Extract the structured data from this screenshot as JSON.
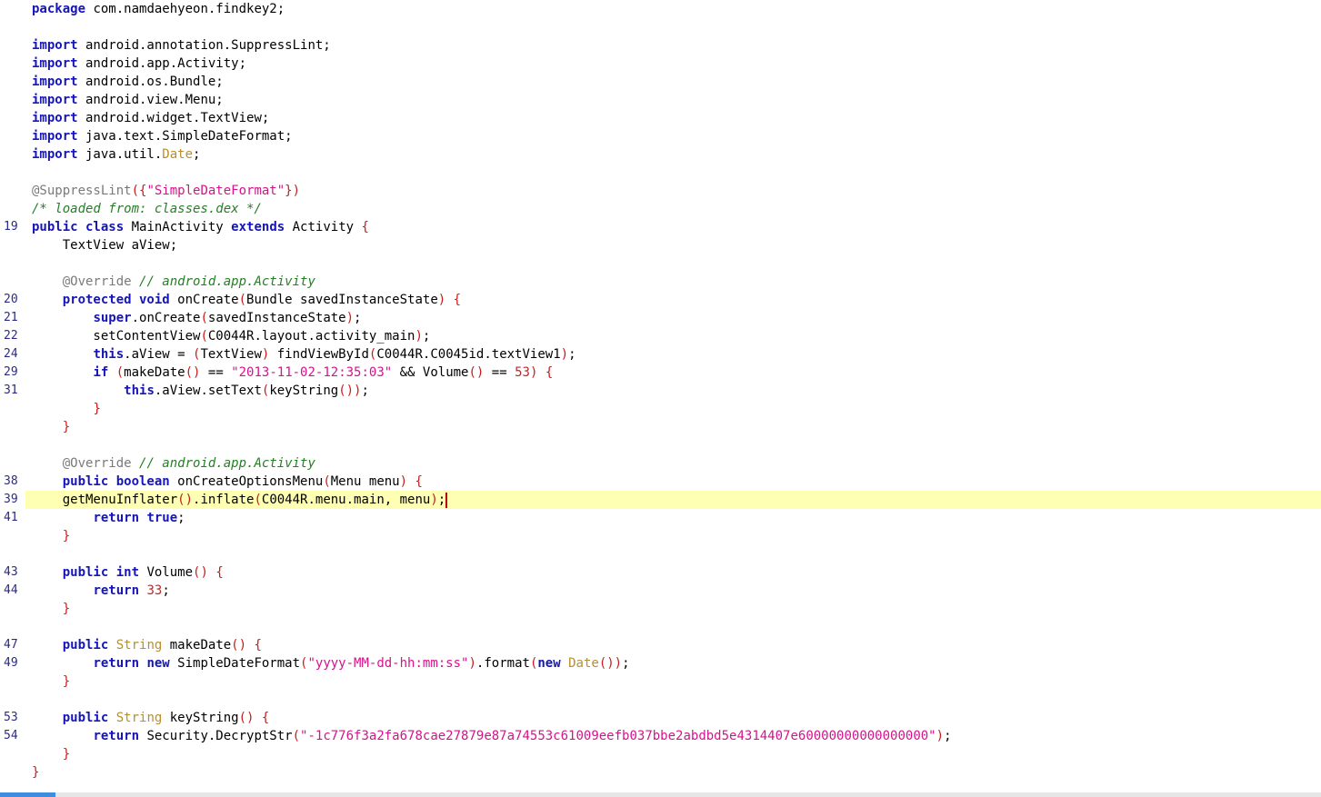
{
  "editor": {
    "lines": [
      {
        "ln": "",
        "tokens": [
          {
            "c": "kw",
            "t": "package"
          },
          {
            "c": "",
            "t": " com.namdaehyeon.findkey2;"
          }
        ]
      },
      {
        "ln": "",
        "tokens": []
      },
      {
        "ln": "",
        "tokens": [
          {
            "c": "kw",
            "t": "import"
          },
          {
            "c": "",
            "t": " android.annotation.SuppressLint;"
          }
        ]
      },
      {
        "ln": "",
        "tokens": [
          {
            "c": "kw",
            "t": "import"
          },
          {
            "c": "",
            "t": " android.app.Activity;"
          }
        ]
      },
      {
        "ln": "",
        "tokens": [
          {
            "c": "kw",
            "t": "import"
          },
          {
            "c": "",
            "t": " android.os.Bundle;"
          }
        ]
      },
      {
        "ln": "",
        "tokens": [
          {
            "c": "kw",
            "t": "import"
          },
          {
            "c": "",
            "t": " android.view.Menu;"
          }
        ]
      },
      {
        "ln": "",
        "tokens": [
          {
            "c": "kw",
            "t": "import"
          },
          {
            "c": "",
            "t": " android.widget.TextView;"
          }
        ]
      },
      {
        "ln": "",
        "tokens": [
          {
            "c": "kw",
            "t": "import"
          },
          {
            "c": "",
            "t": " java.text.SimpleDateFormat;"
          }
        ]
      },
      {
        "ln": "",
        "tokens": [
          {
            "c": "kw",
            "t": "import"
          },
          {
            "c": "",
            "t": " java.util."
          },
          {
            "c": "ty",
            "t": "Date"
          },
          {
            "c": "",
            "t": ";"
          }
        ]
      },
      {
        "ln": "",
        "tokens": []
      },
      {
        "ln": "",
        "tokens": [
          {
            "c": "an",
            "t": "@SuppressLint"
          },
          {
            "c": "br",
            "t": "({"
          },
          {
            "c": "str",
            "t": "\"SimpleDateFormat\""
          },
          {
            "c": "br",
            "t": "})"
          }
        ]
      },
      {
        "ln": "",
        "tokens": [
          {
            "c": "cm",
            "t": "/* loaded from: classes.dex */"
          }
        ]
      },
      {
        "ln": "19",
        "tokens": [
          {
            "c": "kw",
            "t": "public class"
          },
          {
            "c": "",
            "t": " MainActivity "
          },
          {
            "c": "kw",
            "t": "extends"
          },
          {
            "c": "",
            "t": " Activity "
          },
          {
            "c": "br",
            "t": "{"
          }
        ]
      },
      {
        "ln": "",
        "tokens": [
          {
            "c": "",
            "t": "    TextView aView;"
          }
        ]
      },
      {
        "ln": "",
        "tokens": []
      },
      {
        "ln": "",
        "tokens": [
          {
            "c": "",
            "t": "    "
          },
          {
            "c": "an",
            "t": "@Override"
          },
          {
            "c": "",
            "t": " "
          },
          {
            "c": "cm",
            "t": "// android.app.Activity"
          }
        ]
      },
      {
        "ln": "20",
        "tokens": [
          {
            "c": "",
            "t": "    "
          },
          {
            "c": "kw",
            "t": "protected void"
          },
          {
            "c": "",
            "t": " onCreate"
          },
          {
            "c": "br",
            "t": "("
          },
          {
            "c": "",
            "t": "Bundle savedInstanceState"
          },
          {
            "c": "br",
            "t": ")"
          },
          {
            "c": "",
            "t": " "
          },
          {
            "c": "br",
            "t": "{"
          }
        ]
      },
      {
        "ln": "21",
        "tokens": [
          {
            "c": "",
            "t": "        "
          },
          {
            "c": "kw",
            "t": "super"
          },
          {
            "c": "",
            "t": ".onCreate"
          },
          {
            "c": "br",
            "t": "("
          },
          {
            "c": "",
            "t": "savedInstanceState"
          },
          {
            "c": "br",
            "t": ")"
          },
          {
            "c": "",
            "t": ";"
          }
        ]
      },
      {
        "ln": "22",
        "tokens": [
          {
            "c": "",
            "t": "        setContentView"
          },
          {
            "c": "br",
            "t": "("
          },
          {
            "c": "",
            "t": "C0044R.layout.activity_main"
          },
          {
            "c": "br",
            "t": ")"
          },
          {
            "c": "",
            "t": ";"
          }
        ]
      },
      {
        "ln": "24",
        "tokens": [
          {
            "c": "",
            "t": "        "
          },
          {
            "c": "kw",
            "t": "this"
          },
          {
            "c": "",
            "t": ".aView = "
          },
          {
            "c": "br",
            "t": "("
          },
          {
            "c": "",
            "t": "TextView"
          },
          {
            "c": "br",
            "t": ")"
          },
          {
            "c": "",
            "t": " findViewById"
          },
          {
            "c": "br",
            "t": "("
          },
          {
            "c": "",
            "t": "C0044R.C0045id.textView1"
          },
          {
            "c": "br",
            "t": ")"
          },
          {
            "c": "",
            "t": ";"
          }
        ]
      },
      {
        "ln": "29",
        "tokens": [
          {
            "c": "",
            "t": "        "
          },
          {
            "c": "kw",
            "t": "if"
          },
          {
            "c": "",
            "t": " "
          },
          {
            "c": "br",
            "t": "("
          },
          {
            "c": "",
            "t": "makeDate"
          },
          {
            "c": "br",
            "t": "()"
          },
          {
            "c": "",
            "t": " == "
          },
          {
            "c": "str",
            "t": "\"2013-11-02-12:35:03\""
          },
          {
            "c": "",
            "t": " && Volume"
          },
          {
            "c": "br",
            "t": "()"
          },
          {
            "c": "",
            "t": " == "
          },
          {
            "c": "num",
            "t": "53"
          },
          {
            "c": "br",
            "t": ")"
          },
          {
            "c": "",
            "t": " "
          },
          {
            "c": "br",
            "t": "{"
          }
        ]
      },
      {
        "ln": "31",
        "tokens": [
          {
            "c": "",
            "t": "            "
          },
          {
            "c": "kw",
            "t": "this"
          },
          {
            "c": "",
            "t": ".aView.setText"
          },
          {
            "c": "br",
            "t": "("
          },
          {
            "c": "",
            "t": "keyString"
          },
          {
            "c": "br",
            "t": "())"
          },
          {
            "c": "",
            "t": ";"
          }
        ]
      },
      {
        "ln": "",
        "tokens": [
          {
            "c": "",
            "t": "        "
          },
          {
            "c": "br",
            "t": "}"
          }
        ]
      },
      {
        "ln": "",
        "tokens": [
          {
            "c": "",
            "t": "    "
          },
          {
            "c": "br",
            "t": "}"
          }
        ]
      },
      {
        "ln": "",
        "tokens": []
      },
      {
        "ln": "",
        "tokens": [
          {
            "c": "",
            "t": "    "
          },
          {
            "c": "an",
            "t": "@Override"
          },
          {
            "c": "",
            "t": " "
          },
          {
            "c": "cm",
            "t": "// android.app.Activity"
          }
        ]
      },
      {
        "ln": "38",
        "tokens": [
          {
            "c": "",
            "t": "    "
          },
          {
            "c": "kw",
            "t": "public boolean"
          },
          {
            "c": "",
            "t": " onCreateOptionsMenu"
          },
          {
            "c": "br",
            "t": "("
          },
          {
            "c": "",
            "t": "Menu menu"
          },
          {
            "c": "br",
            "t": ")"
          },
          {
            "c": "",
            "t": " "
          },
          {
            "c": "br",
            "t": "{"
          }
        ]
      },
      {
        "ln": "39",
        "current": true,
        "tokens": [
          {
            "c": "",
            "t": "    getMenuInflater"
          },
          {
            "c": "br",
            "t": "()"
          },
          {
            "c": "",
            "t": ".inflate"
          },
          {
            "c": "br",
            "t": "("
          },
          {
            "c": "",
            "t": "C0044R.menu.main, menu"
          },
          {
            "c": "br",
            "t": ")"
          },
          {
            "c": "",
            "t": ";"
          }
        ]
      },
      {
        "ln": "41",
        "tokens": [
          {
            "c": "",
            "t": "        "
          },
          {
            "c": "kw",
            "t": "return true"
          },
          {
            "c": "",
            "t": ";"
          }
        ]
      },
      {
        "ln": "",
        "tokens": [
          {
            "c": "",
            "t": "    "
          },
          {
            "c": "br",
            "t": "}"
          }
        ]
      },
      {
        "ln": "",
        "tokens": []
      },
      {
        "ln": "43",
        "tokens": [
          {
            "c": "",
            "t": "    "
          },
          {
            "c": "kw",
            "t": "public int"
          },
          {
            "c": "",
            "t": " Volume"
          },
          {
            "c": "br",
            "t": "()"
          },
          {
            "c": "",
            "t": " "
          },
          {
            "c": "br",
            "t": "{"
          }
        ]
      },
      {
        "ln": "44",
        "tokens": [
          {
            "c": "",
            "t": "        "
          },
          {
            "c": "kw",
            "t": "return"
          },
          {
            "c": "",
            "t": " "
          },
          {
            "c": "num",
            "t": "33"
          },
          {
            "c": "",
            "t": ";"
          }
        ]
      },
      {
        "ln": "",
        "tokens": [
          {
            "c": "",
            "t": "    "
          },
          {
            "c": "br",
            "t": "}"
          }
        ]
      },
      {
        "ln": "",
        "tokens": []
      },
      {
        "ln": "47",
        "tokens": [
          {
            "c": "",
            "t": "    "
          },
          {
            "c": "kw",
            "t": "public"
          },
          {
            "c": "",
            "t": " "
          },
          {
            "c": "ty",
            "t": "String"
          },
          {
            "c": "",
            "t": " makeDate"
          },
          {
            "c": "br",
            "t": "()"
          },
          {
            "c": "",
            "t": " "
          },
          {
            "c": "br",
            "t": "{"
          }
        ]
      },
      {
        "ln": "49",
        "tokens": [
          {
            "c": "",
            "t": "        "
          },
          {
            "c": "kw",
            "t": "return new"
          },
          {
            "c": "",
            "t": " SimpleDateFormat"
          },
          {
            "c": "br",
            "t": "("
          },
          {
            "c": "str",
            "t": "\"yyyy-MM-dd-hh:mm:ss\""
          },
          {
            "c": "br",
            "t": ")"
          },
          {
            "c": "",
            "t": ".format"
          },
          {
            "c": "br",
            "t": "("
          },
          {
            "c": "kw",
            "t": "new"
          },
          {
            "c": "",
            "t": " "
          },
          {
            "c": "ty",
            "t": "Date"
          },
          {
            "c": "br",
            "t": "())"
          },
          {
            "c": "",
            "t": ";"
          }
        ]
      },
      {
        "ln": "",
        "tokens": [
          {
            "c": "",
            "t": "    "
          },
          {
            "c": "br",
            "t": "}"
          }
        ]
      },
      {
        "ln": "",
        "tokens": []
      },
      {
        "ln": "53",
        "tokens": [
          {
            "c": "",
            "t": "    "
          },
          {
            "c": "kw",
            "t": "public"
          },
          {
            "c": "",
            "t": " "
          },
          {
            "c": "ty",
            "t": "String"
          },
          {
            "c": "",
            "t": " keyString"
          },
          {
            "c": "br",
            "t": "()"
          },
          {
            "c": "",
            "t": " "
          },
          {
            "c": "br",
            "t": "{"
          }
        ]
      },
      {
        "ln": "54",
        "tokens": [
          {
            "c": "",
            "t": "        "
          },
          {
            "c": "kw",
            "t": "return"
          },
          {
            "c": "",
            "t": " Security.DecryptStr"
          },
          {
            "c": "br",
            "t": "("
          },
          {
            "c": "str",
            "t": "\"-1c776f3a2fa678cae27879e87a74553c61009eefb037bbe2abdbd5e4314407e60000000000000000\""
          },
          {
            "c": "br",
            "t": ")"
          },
          {
            "c": "",
            "t": ";"
          }
        ]
      },
      {
        "ln": "",
        "tokens": [
          {
            "c": "",
            "t": "    "
          },
          {
            "c": "br",
            "t": "}"
          }
        ]
      },
      {
        "ln": "",
        "tokens": [
          {
            "c": "br",
            "t": "}"
          }
        ]
      }
    ]
  },
  "colors": {
    "keyword": "#1515b8",
    "type": "#b88f2a",
    "string": "#d4148a",
    "number": "#b82a2a",
    "comment": "#257f25",
    "annotation": "#7a7a7a",
    "bracket": "#c91b1b",
    "line_number": "#2a2a8a",
    "current_line": "#ffffb4",
    "caret": "#c00000",
    "scrollbar_thumb": "#3d8ee0"
  }
}
